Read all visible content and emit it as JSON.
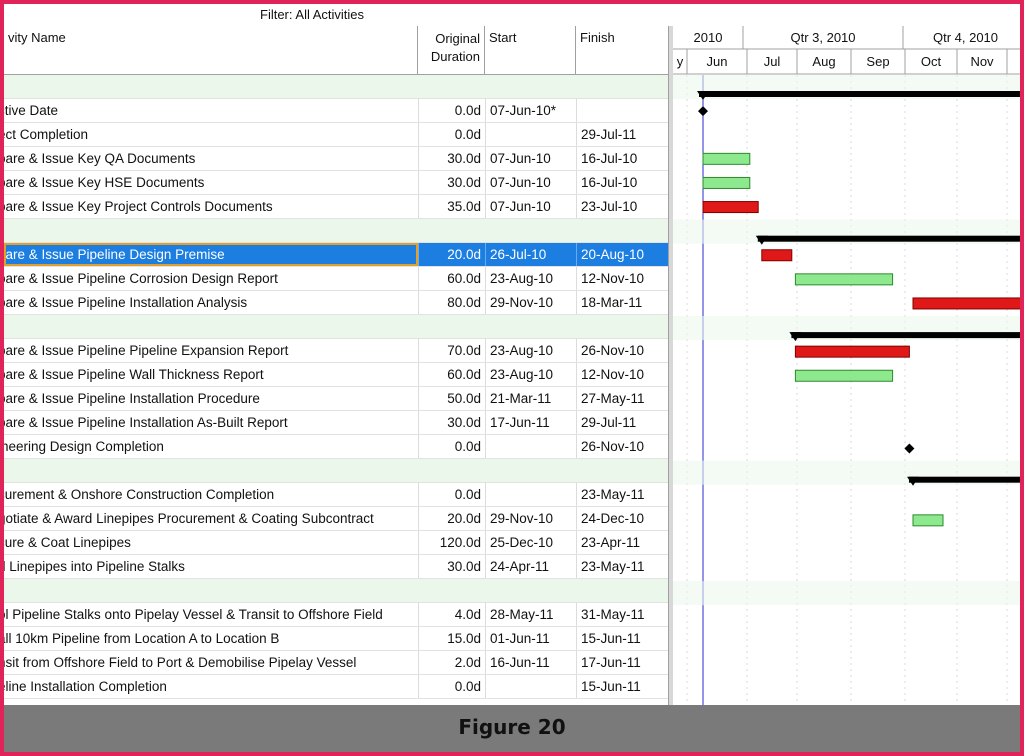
{
  "filter": {
    "label": "Filter: All Activities"
  },
  "columns": {
    "name": "vity Name",
    "duration_line1": "Original",
    "duration_line2": "Duration",
    "start": "Start",
    "finish": "Finish"
  },
  "timeline": {
    "years": [
      "2010",
      "Qtr 3, 2010",
      "Qtr 4, 2010"
    ],
    "months": [
      "y",
      "Jun",
      "Jul",
      "Aug",
      "Sep",
      "Oct",
      "Nov"
    ]
  },
  "rows": [
    {
      "type": "group"
    },
    {
      "name": "ctive Date",
      "duration": "0.0d",
      "start": "07-Jun-10*",
      "finish": "",
      "bar": "milestone",
      "bar_start": 0,
      "bar_end": 0
    },
    {
      "name": "ect Completion",
      "duration": "0.0d",
      "start": "",
      "finish": "29-Jul-11",
      "bar": "none"
    },
    {
      "name": "pare & Issue Key QA Documents",
      "duration": "30.0d",
      "start": "07-Jun-10",
      "finish": "16-Jul-10",
      "bar": "green",
      "bar_start": 0,
      "bar_end": 39
    },
    {
      "name": "pare & Issue Key HSE Documents",
      "duration": "30.0d",
      "start": "07-Jun-10",
      "finish": "16-Jul-10",
      "bar": "green",
      "bar_start": 0,
      "bar_end": 39
    },
    {
      "name": "pare & Issue Key Project Controls Documents",
      "duration": "35.0d",
      "start": "07-Jun-10",
      "finish": "23-Jul-10",
      "bar": "red",
      "bar_start": 0,
      "bar_end": 46
    },
    {
      "type": "group",
      "summary_start": 49,
      "summary_end": 999
    },
    {
      "name": "pare & Issue Pipeline Design Premise",
      "duration": "20.0d",
      "start": "26-Jul-10",
      "finish": "20-Aug-10",
      "bar": "red",
      "bar_start": 49,
      "bar_end": 74,
      "selected": true
    },
    {
      "name": "pare & Issue Pipeline Corrosion Design Report",
      "duration": "60.0d",
      "start": "23-Aug-10",
      "finish": "12-Nov-10",
      "bar": "green",
      "bar_start": 77,
      "bar_end": 158
    },
    {
      "name": "pare & Issue Pipeline Installation Analysis",
      "duration": "80.0d",
      "start": "29-Nov-10",
      "finish": "18-Mar-11",
      "bar": "red",
      "bar_start": 175,
      "bar_end": 284
    },
    {
      "type": "group",
      "summary_start": 77,
      "summary_end": 999
    },
    {
      "name": "pare & Issue Pipeline Pipeline Expansion Report",
      "duration": "70.0d",
      "start": "23-Aug-10",
      "finish": "26-Nov-10",
      "bar": "red",
      "bar_start": 77,
      "bar_end": 172
    },
    {
      "name": "pare & Issue Pipeline Wall Thickness Report",
      "duration": "60.0d",
      "start": "23-Aug-10",
      "finish": "12-Nov-10",
      "bar": "green",
      "bar_start": 77,
      "bar_end": 158
    },
    {
      "name": "pare & Issue Pipeline Installation Procedure",
      "duration": "50.0d",
      "start": "21-Mar-11",
      "finish": "27-May-11",
      "bar": "none"
    },
    {
      "name": "pare & Issue Pipeline Installation As-Built Report",
      "duration": "30.0d",
      "start": "17-Jun-11",
      "finish": "29-Jul-11",
      "bar": "none"
    },
    {
      "name": "ineering Design Completion",
      "duration": "0.0d",
      "start": "",
      "finish": "26-Nov-10",
      "bar": "milestone",
      "bar_start": 172,
      "bar_end": 172
    },
    {
      "type": "group",
      "summary_start": 175,
      "summary_end": 999
    },
    {
      "name": "curement & Onshore Construction Completion",
      "duration": "0.0d",
      "start": "",
      "finish": "23-May-11",
      "bar": "none"
    },
    {
      "name": "gotiate & Award Linepipes Procurement & Coating Subcontract",
      "duration": "20.0d",
      "start": "29-Nov-10",
      "finish": "24-Dec-10",
      "bar": "green",
      "bar_start": 175,
      "bar_end": 200
    },
    {
      "name": "cure & Coat Linepipes",
      "duration": "120.0d",
      "start": "25-Dec-10",
      "finish": "23-Apr-11",
      "bar": "none"
    },
    {
      "name": "d Linepipes into Pipeline Stalks",
      "duration": "30.0d",
      "start": "24-Apr-11",
      "finish": "23-May-11",
      "bar": "none"
    },
    {
      "type": "group"
    },
    {
      "name": "ol Pipeline Stalks onto Pipelay Vessel & Transit to Offshore Field",
      "duration": "4.0d",
      "start": "28-May-11",
      "finish": "31-May-11",
      "bar": "none"
    },
    {
      "name": "all 10km Pipeline from Location A to Location B",
      "duration": "15.0d",
      "start": "01-Jun-11",
      "finish": "15-Jun-11",
      "bar": "none"
    },
    {
      "name": "nsit from Offshore Field to Port & Demobilise Pipelay Vessel",
      "duration": "2.0d",
      "start": "16-Jun-11",
      "finish": "17-Jun-11",
      "bar": "none"
    },
    {
      "name": "eline Installation Completion",
      "duration": "0.0d",
      "start": "",
      "finish": "15-Jun-11",
      "bar": "none"
    }
  ],
  "colors": {
    "bar_green": "#8ee88e",
    "bar_red": "#e01818",
    "selected": "#1b7ee0",
    "group_band": "#ecf7ec",
    "data_date_line": "#2a2ad0"
  },
  "caption": "Figure 20"
}
